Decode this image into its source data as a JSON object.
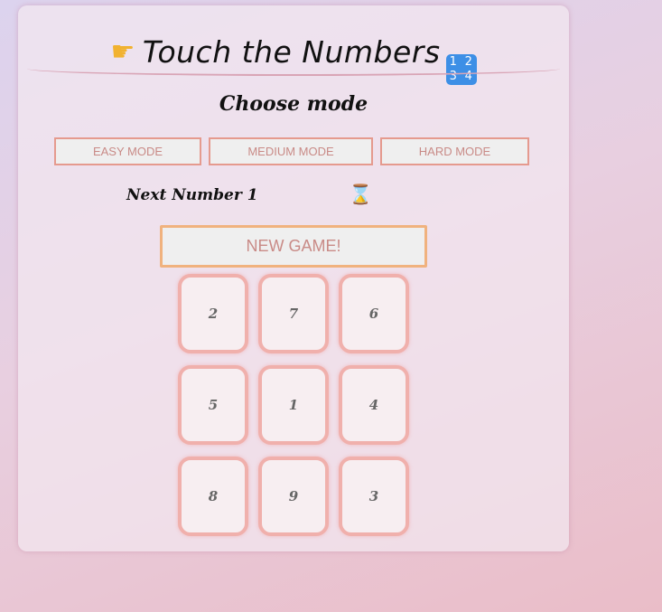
{
  "header": {
    "title": "Touch the Numbers",
    "hand_icon": "pointing-right-hand-icon",
    "numbers_icon": "input-numbers-icon",
    "numbers_icon_digits": [
      "1",
      "2",
      "3",
      "4"
    ]
  },
  "mode": {
    "heading": "Choose mode",
    "buttons": [
      "EASY MODE",
      "MEDIUM MODE",
      "HARD MODE"
    ]
  },
  "status": {
    "next_label": "Next Number 1",
    "timer_icon": "hourglass-icon"
  },
  "game": {
    "new_game_label": "NEW GAME!",
    "tiles": [
      "2",
      "7",
      "6",
      "5",
      "1",
      "4",
      "8",
      "9",
      "3"
    ]
  },
  "colors": {
    "accent_border": "#e59a8e",
    "tile_border": "#f0b0ac",
    "new_game_border": "#f0b27e",
    "button_text": "#c98b87"
  }
}
